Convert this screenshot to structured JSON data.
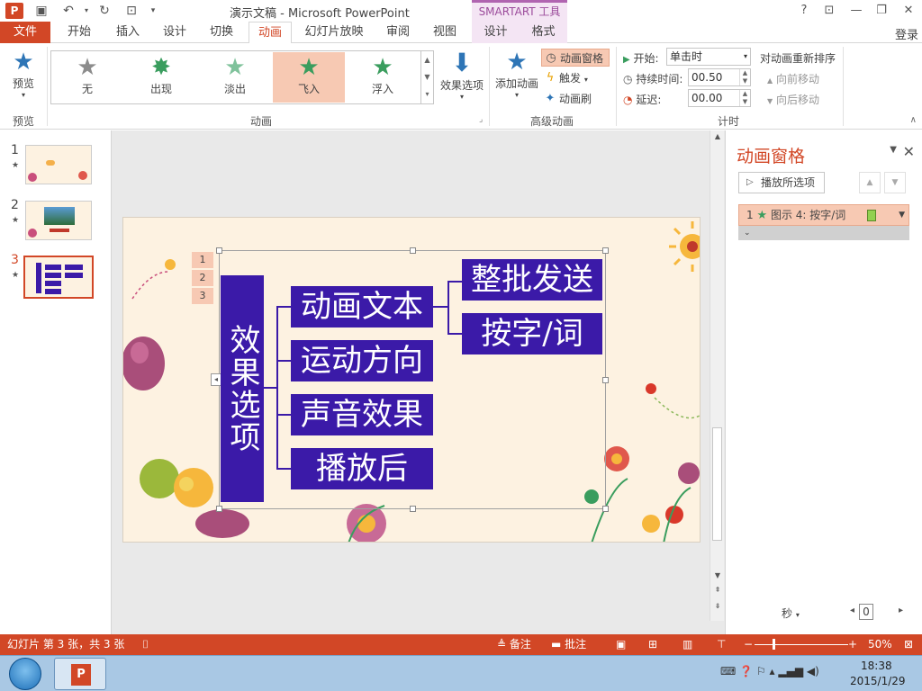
{
  "titlebar": {
    "logo": "P",
    "title": "演示文稿 - Microsoft PowerPoint",
    "smartart_tools": "SMARTART 工具",
    "help": "?",
    "restore_ribbon": "⊡",
    "minimize": "—",
    "maximize": "❐",
    "close": "✕"
  },
  "tabs": {
    "file": "文件",
    "home": "开始",
    "insert": "插入",
    "design": "设计",
    "transitions": "切换",
    "animations": "动画",
    "slideshow": "幻灯片放映",
    "review": "审阅",
    "view": "视图",
    "sa_design": "设计",
    "sa_format": "格式",
    "login": "登录"
  },
  "ribbon": {
    "preview": {
      "label": "预览",
      "group": "预览"
    },
    "animations": {
      "items": [
        {
          "label": "无",
          "icon": "none-star-icon",
          "color": "#8c8c8c"
        },
        {
          "label": "出现",
          "icon": "appear-star-icon",
          "color": "#3a9d5e"
        },
        {
          "label": "淡出",
          "icon": "fade-star-icon",
          "color": "#7fc29b"
        },
        {
          "label": "飞入",
          "icon": "fly-in-star-icon",
          "color": "#3a9d5e"
        },
        {
          "label": "浮入",
          "icon": "float-in-star-icon",
          "color": "#3a9d5e"
        }
      ],
      "selected_index": 3,
      "group": "动画"
    },
    "effect_options": "效果选项",
    "add_animation": "添加动画",
    "animation_pane": "动画窗格",
    "trigger": "触发",
    "painter": "动画刷",
    "advanced_group": "高级动画",
    "timing": {
      "start_label": "开始:",
      "start_value": "单击时",
      "duration_label": "持续时间:",
      "duration_value": "00.50",
      "delay_label": "延迟:",
      "delay_value": "00.00",
      "reorder_title": "对动画重新排序",
      "move_earlier": "向前移动",
      "move_later": "向后移动",
      "group": "计时"
    }
  },
  "thumbnails": [
    {
      "num": "1",
      "star": "★"
    },
    {
      "num": "2",
      "star": "★"
    },
    {
      "num": "3",
      "star": "★"
    }
  ],
  "slide": {
    "markers": [
      "1",
      "2",
      "3"
    ],
    "root": "效果选项",
    "children": [
      "动画文本",
      "运动方向",
      "声音效果",
      "播放后"
    ],
    "grandchildren": [
      "整批发送",
      "按字/词"
    ]
  },
  "animpane": {
    "title": "动画窗格",
    "play_from": "播放所选项",
    "item": {
      "num": "1",
      "label": "图示 4: 按字/词"
    },
    "seconds": "秒",
    "timeline_value": "0"
  },
  "statusbar": {
    "slide_info": "幻灯片 第 3 张，共 3 张",
    "notes": "备注",
    "comments": "批注",
    "zoom": "50%"
  },
  "taskbar": {
    "time": "18:38",
    "date": "2015/1/29"
  },
  "colors": {
    "accent": "#d24726",
    "smartart_fill": "#3b1aa8",
    "selection": "#f7c9b3"
  }
}
